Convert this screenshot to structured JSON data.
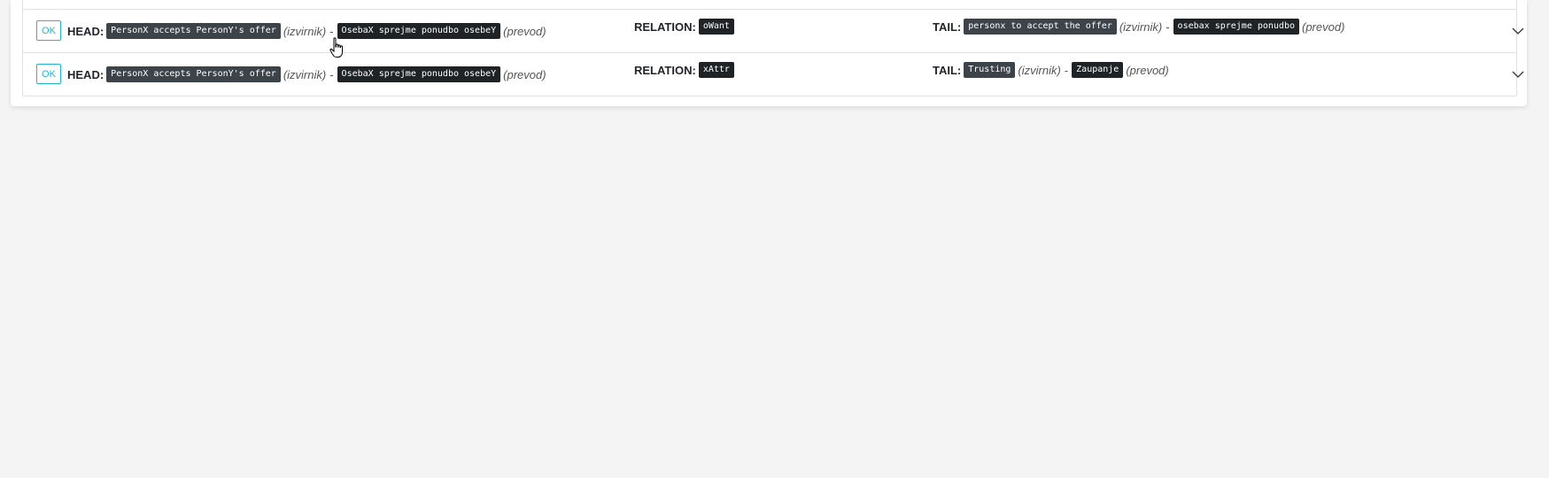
{
  "rows": [
    {
      "status": "OK",
      "head_label": "HEAD:",
      "head_source": "PersonX accepts PersonY's offer",
      "source_tag": "(izvirnik)",
      "dash": "-",
      "head_translation": "OsebaX sprejme ponudbo osebeY",
      "translation_tag": "(prevod)",
      "relation_label": "RELATION:",
      "relation": "oWant",
      "tail_label": "TAIL:",
      "tail_source": "personx to accept the offer",
      "tail_translation": "osebax sprejme ponudbo"
    },
    {
      "status": "OK",
      "head_label": "HEAD:",
      "head_source": "PersonX accepts PersonY's offer",
      "source_tag": "(izvirnik)",
      "dash": "-",
      "head_translation": "OsebaX sprejme ponudbo osebeY",
      "translation_tag": "(prevod)",
      "relation_label": "RELATION:",
      "relation": "xAttr",
      "tail_label": "TAIL:",
      "tail_source": "Trusting",
      "tail_translation": "Zaupanje"
    }
  ],
  "icons": {
    "expand": "chevron-down-icon",
    "cursor": "hand-pointer-icon"
  },
  "colors": {
    "accent": "#22b6d6",
    "source_tag_bg": "#3c4449",
    "translation_tag_bg": "#1f2326",
    "page_bg": "#f4f4f4"
  }
}
